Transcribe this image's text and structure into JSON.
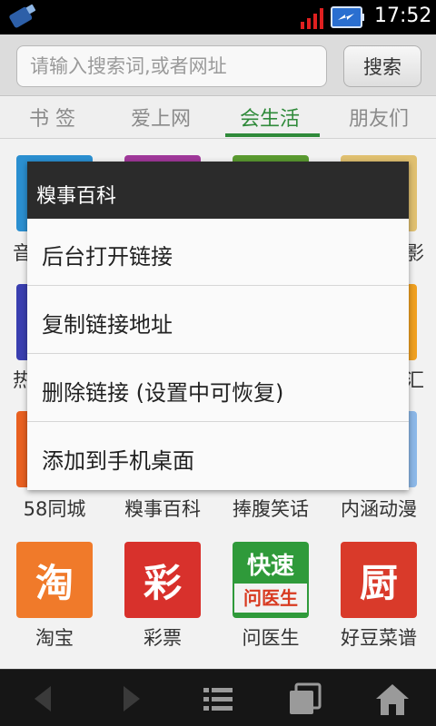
{
  "status_bar": {
    "time": "17:52"
  },
  "search": {
    "placeholder": "请输入搜索词,或者网址",
    "button_label": "搜索"
  },
  "tabs": [
    {
      "label": "书 签",
      "active": false
    },
    {
      "label": "爱上网",
      "active": false
    },
    {
      "label": "会生活",
      "active": true
    },
    {
      "label": "朋友们",
      "active": false
    }
  ],
  "grid": {
    "partial_labels": {
      "row1_left": "音",
      "row1_right": "影",
      "row2_left": "热",
      "row2_right": "汇"
    },
    "row3": [
      "58同城",
      "糗事百科",
      "捧腹笑话",
      "内涵动漫"
    ],
    "row4": [
      {
        "label": "淘宝",
        "glyph": "淘",
        "color": "#f07a2a"
      },
      {
        "label": "彩票",
        "glyph": "彩",
        "color": "#d8312c"
      },
      {
        "label": "问医生",
        "glyph_top": "快速",
        "glyph_bottom": "问医生",
        "color": "#2f9a3a"
      },
      {
        "label": "好豆菜谱",
        "glyph": "厨",
        "color": "#d93a2a"
      }
    ]
  },
  "context_menu": {
    "title": "糗事百科",
    "items": [
      "后台打开链接",
      "复制链接地址",
      "删除链接 (设置中可恢复)",
      "添加到手机桌面"
    ]
  },
  "toolbar": {
    "buttons": [
      "back-icon",
      "forward-icon",
      "menu-icon",
      "windows-icon",
      "home-icon"
    ]
  },
  "colors": {
    "accent": "#2f8a3a",
    "menu_title_bg": "#2b2b2b",
    "toolbar_bg": "#161616"
  }
}
